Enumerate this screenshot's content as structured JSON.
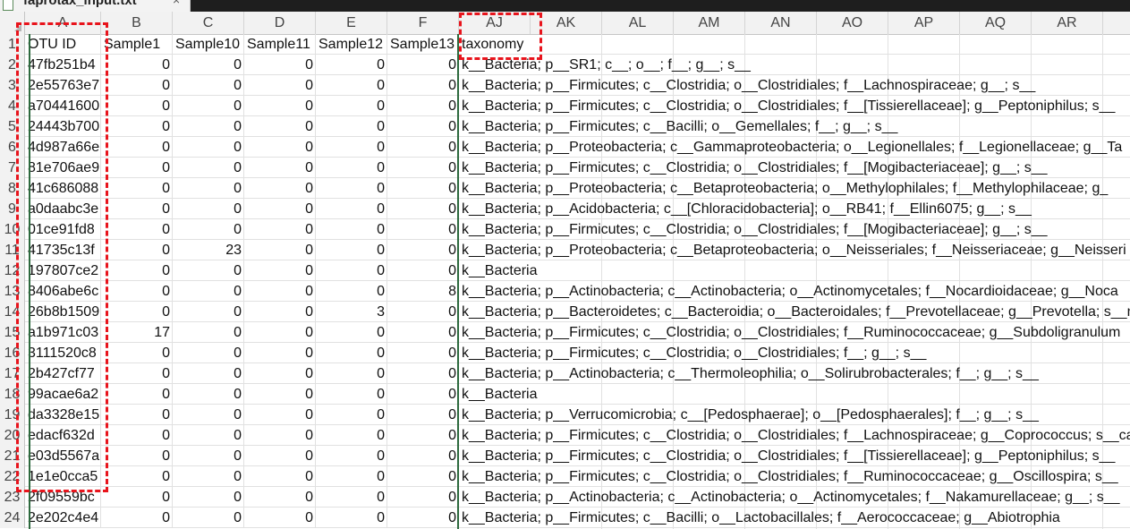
{
  "tab": {
    "filename": "faprotax_input.txt",
    "close": "×",
    "icon": "text-file-icon"
  },
  "columns": [
    "A",
    "B",
    "C",
    "D",
    "E",
    "F",
    "AJ",
    "AK",
    "AL",
    "AM",
    "AN",
    "AO",
    "AP",
    "AQ",
    "AR"
  ],
  "header_row": {
    "num": "1",
    "cells": [
      "OTU ID",
      "Sample1",
      "Sample10",
      "Sample11",
      "Sample12",
      "Sample13",
      "taxonomy"
    ]
  },
  "rows": [
    {
      "num": "2",
      "id": "47fb251b4",
      "v": [
        "0",
        "0",
        "0",
        "0",
        "0"
      ],
      "tax": "k__Bacteria; p__SR1; c__; o__; f__; g__; s__"
    },
    {
      "num": "3",
      "id": "2e55763e7",
      "v": [
        "0",
        "0",
        "0",
        "0",
        "0"
      ],
      "tax": "k__Bacteria; p__Firmicutes; c__Clostridia; o__Clostridiales; f__Lachnospiraceae; g__; s__"
    },
    {
      "num": "4",
      "id": "a70441600",
      "v": [
        "0",
        "0",
        "0",
        "0",
        "0"
      ],
      "tax": "k__Bacteria; p__Firmicutes; c__Clostridia; o__Clostridiales; f__[Tissierellaceae]; g__Peptoniphilus; s__"
    },
    {
      "num": "5",
      "id": "24443b700",
      "v": [
        "0",
        "0",
        "0",
        "0",
        "0"
      ],
      "tax": "k__Bacteria; p__Firmicutes; c__Bacilli; o__Gemellales; f__; g__; s__"
    },
    {
      "num": "6",
      "id": "4d987a66e",
      "v": [
        "0",
        "0",
        "0",
        "0",
        "0"
      ],
      "tax": "k__Bacteria; p__Proteobacteria; c__Gammaproteobacteria; o__Legionellales; f__Legionellaceae; g__Ta"
    },
    {
      "num": "7",
      "id": "81e706ae9",
      "v": [
        "0",
        "0",
        "0",
        "0",
        "0"
      ],
      "tax": "k__Bacteria; p__Firmicutes; c__Clostridia; o__Clostridiales; f__[Mogibacteriaceae]; g__; s__"
    },
    {
      "num": "8",
      "id": "41c686088",
      "v": [
        "0",
        "0",
        "0",
        "0",
        "0"
      ],
      "tax": "k__Bacteria; p__Proteobacteria; c__Betaproteobacteria; o__Methylophilales; f__Methylophilaceae; g_"
    },
    {
      "num": "9",
      "id": "a0daabc3e",
      "v": [
        "0",
        "0",
        "0",
        "0",
        "0"
      ],
      "tax": "k__Bacteria; p__Acidobacteria; c__[Chloracidobacteria]; o__RB41; f__Ellin6075; g__; s__"
    },
    {
      "num": "10",
      "id": "01ce91fd8",
      "v": [
        "0",
        "0",
        "0",
        "0",
        "0"
      ],
      "tax": "k__Bacteria; p__Firmicutes; c__Clostridia; o__Clostridiales; f__[Mogibacteriaceae]; g__; s__"
    },
    {
      "num": "11",
      "id": "41735c13f",
      "v": [
        "0",
        "23",
        "0",
        "0",
        "0"
      ],
      "tax": "k__Bacteria; p__Proteobacteria; c__Betaproteobacteria; o__Neisseriales; f__Neisseriaceae; g__Neisseri"
    },
    {
      "num": "12",
      "id": "197807ce2",
      "v": [
        "0",
        "0",
        "0",
        "0",
        "0"
      ],
      "tax": "k__Bacteria"
    },
    {
      "num": "13",
      "id": "8406abe6c",
      "v": [
        "0",
        "0",
        "0",
        "0",
        "8"
      ],
      "tax": "k__Bacteria; p__Actinobacteria; c__Actinobacteria; o__Actinomycetales; f__Nocardioidaceae; g__Noca"
    },
    {
      "num": "14",
      "id": "26b8b1509",
      "v": [
        "0",
        "0",
        "0",
        "3",
        "0"
      ],
      "tax": "k__Bacteria; p__Bacteroidetes; c__Bacteroidia; o__Bacteroidales; f__Prevotellaceae; g__Prevotella; s__m"
    },
    {
      "num": "15",
      "id": "a1b971c03",
      "v": [
        "17",
        "0",
        "0",
        "0",
        "0"
      ],
      "tax": "k__Bacteria; p__Firmicutes; c__Clostridia; o__Clostridiales; f__Ruminococcaceae; g__Subdoligranulum"
    },
    {
      "num": "16",
      "id": "3111520c8",
      "v": [
        "0",
        "0",
        "0",
        "0",
        "0"
      ],
      "tax": "k__Bacteria; p__Firmicutes; c__Clostridia; o__Clostridiales; f__; g__; s__"
    },
    {
      "num": "17",
      "id": "2b427cf77",
      "v": [
        "0",
        "0",
        "0",
        "0",
        "0"
      ],
      "tax": "k__Bacteria; p__Actinobacteria; c__Thermoleophilia; o__Solirubrobacterales; f__; g__; s__"
    },
    {
      "num": "18",
      "id": "99acae6a2",
      "v": [
        "0",
        "0",
        "0",
        "0",
        "0"
      ],
      "tax": "k__Bacteria"
    },
    {
      "num": "19",
      "id": "da3328e15",
      "v": [
        "0",
        "0",
        "0",
        "0",
        "0"
      ],
      "tax": "k__Bacteria; p__Verrucomicrobia; c__[Pedosphaerae]; o__[Pedosphaerales]; f__; g__; s__"
    },
    {
      "num": "20",
      "id": "edacf632d",
      "v": [
        "0",
        "0",
        "0",
        "0",
        "0"
      ],
      "tax": "k__Bacteria; p__Firmicutes; c__Clostridia; o__Clostridiales; f__Lachnospiraceae; g__Coprococcus; s__ca"
    },
    {
      "num": "21",
      "id": "e03d5567a",
      "v": [
        "0",
        "0",
        "0",
        "0",
        "0"
      ],
      "tax": "k__Bacteria; p__Firmicutes; c__Clostridia; o__Clostridiales; f__[Tissierellaceae]; g__Peptoniphilus; s__"
    },
    {
      "num": "22",
      "id": "1e1e0cca5",
      "v": [
        "0",
        "0",
        "0",
        "0",
        "0"
      ],
      "tax": "k__Bacteria; p__Firmicutes; c__Clostridia; o__Clostridiales; f__Ruminococcaceae; g__Oscillospira; s__"
    },
    {
      "num": "23",
      "id": "2f09559bc",
      "v": [
        "0",
        "0",
        "0",
        "0",
        "0"
      ],
      "tax": "k__Bacteria; p__Actinobacteria; c__Actinobacteria; o__Actinomycetales; f__Nakamurellaceae; g__; s__"
    },
    {
      "num": "24",
      "id": "2e202c4e4",
      "v": [
        "0",
        "0",
        "0",
        "0",
        "0"
      ],
      "tax": "k__Bacteria; p__Firmicutes; c__Bacilli; o__Lactobacillales; f__Aerococcaceae; g__Abiotrophia"
    }
  ],
  "colors": {
    "highlight": "#e8141c",
    "frozen_divider": "#2d6a3e",
    "header_bg": "#f2f2f2"
  }
}
